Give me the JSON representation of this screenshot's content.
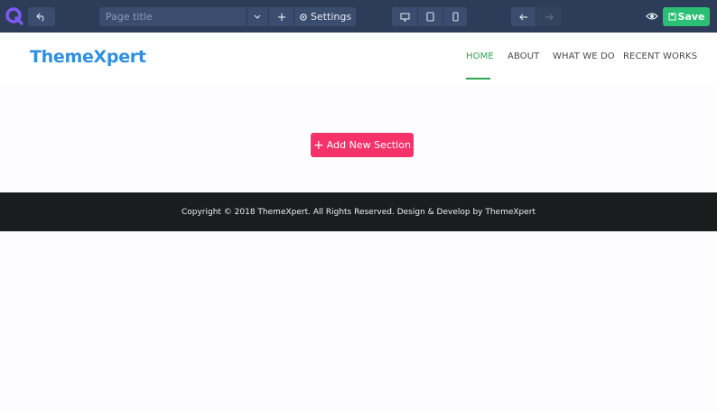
{
  "toolbar": {
    "page_title_placeholder": "Page title",
    "settings_label": "Settings",
    "save_label": "Save",
    "colors": {
      "bar": "#2d3c59",
      "button": "#3b4d6e",
      "save": "#2bbf75"
    },
    "icons": [
      "builder-logo-icon",
      "undo-icon",
      "chevron-down-icon",
      "plus-icon",
      "gear-icon",
      "desktop-icon",
      "tablet-icon",
      "mobile-icon",
      "arrow-left-icon",
      "arrow-right-icon",
      "eye-icon",
      "save-icon"
    ]
  },
  "site": {
    "brand": "ThemeXpert",
    "nav": [
      {
        "label": "HOME",
        "active": true
      },
      {
        "label": "ABOUT",
        "active": false
      },
      {
        "label": "WHAT WE DO",
        "active": false
      },
      {
        "label": "RECENT WORKS",
        "active": false
      }
    ],
    "colors": {
      "brand": "#2f8fe0",
      "nav_active": "#2da650"
    }
  },
  "canvas": {
    "add_section_label": "Add New Section",
    "add_section_color": "#f5336a"
  },
  "footer": {
    "copyright": "Copyright © 2018 ThemeXpert. All Rights Reserved. Design & Develop by ThemeXpert",
    "background": "#1b1c1e"
  }
}
